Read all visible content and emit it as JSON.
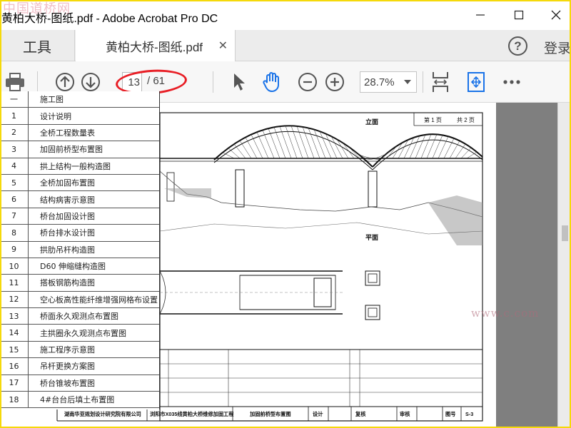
{
  "window": {
    "title": "黄柏大桥-图纸.pdf - Adobe Acrobat Pro DC",
    "watermark": "中国道桥网",
    "bottom_watermark": "www.c.com"
  },
  "tabs": {
    "tools_label": "工具",
    "doc_label": "黄柏大桥-图纸.pdf",
    "login_label": "登录"
  },
  "toolbar": {
    "page_current": "13",
    "page_total": "/ 61",
    "zoom": "28.7%"
  },
  "toc": {
    "rows": [
      {
        "num": "一",
        "name": "施工图"
      },
      {
        "num": "1",
        "name": "设计说明"
      },
      {
        "num": "2",
        "name": "全桥工程数量表"
      },
      {
        "num": "3",
        "name": "加固前桥型布置图"
      },
      {
        "num": "4",
        "name": "拱上结构一般构造图"
      },
      {
        "num": "5",
        "name": "全桥加固布置图"
      },
      {
        "num": "6",
        "name": "结构病害示意图"
      },
      {
        "num": "7",
        "name": "桥台加固设计图"
      },
      {
        "num": "8",
        "name": "桥台排水设计图"
      },
      {
        "num": "9",
        "name": "拱肋吊杆构造图"
      },
      {
        "num": "10",
        "name": "D60 伸缩缝构造图"
      },
      {
        "num": "11",
        "name": "搭板钢筋构造图"
      },
      {
        "num": "12",
        "name": "空心板高性能纤维增强网格布设置"
      },
      {
        "num": "13",
        "name": "桥面永久观测点布置图"
      },
      {
        "num": "14",
        "name": "主拱圈永久观测点布置图"
      },
      {
        "num": "15",
        "name": "施工程序示意图"
      },
      {
        "num": "16",
        "name": "吊杆更换方案图"
      },
      {
        "num": "17",
        "name": "桥台锥坡布置图"
      },
      {
        "num": "18",
        "name": "4#台台后填土布置图"
      }
    ]
  },
  "drawing": {
    "elevation_label": "立面",
    "plan_label": "平面",
    "sheet_label": "第 1 页",
    "sheet_total": "共 2 页",
    "company": "湖南华亚规划设计研究院有限公司",
    "project": "浏阳市X035线黄柏大桥维修加固工程",
    "drawing_name": "加固前桥型布置图",
    "design": "设计",
    "review": "复核",
    "approve": "审核",
    "fig_no": "图号",
    "fig_val": "S-3"
  },
  "colors": {
    "highlight_ellipse": "#e81e25",
    "frame": "#f5d90a",
    "icon_blue": "#1a73e8"
  }
}
